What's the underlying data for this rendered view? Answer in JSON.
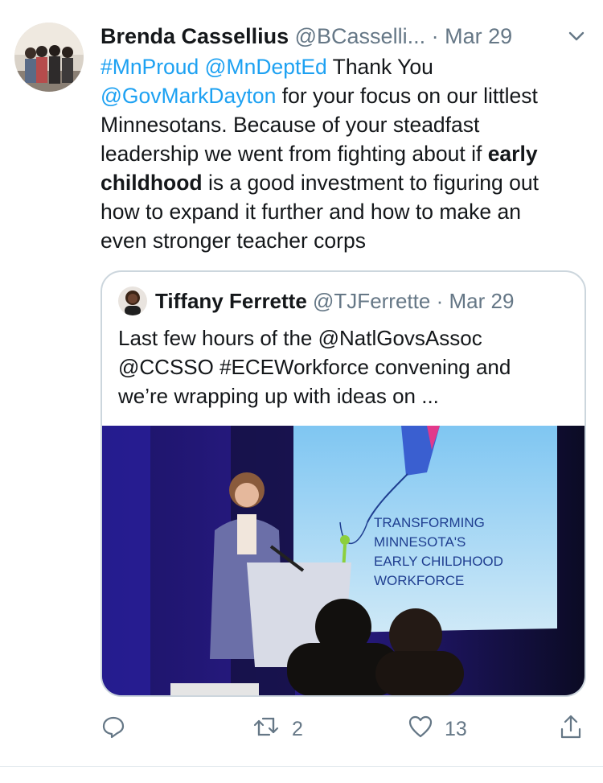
{
  "tweet": {
    "author_name": "Brenda Cassellius",
    "author_handle": "@BCasselli...",
    "separator": "·",
    "date": "Mar 29",
    "text_segments": {
      "s1": "#MnProud",
      "s2": "@MnDeptEd",
      "s3": " Thank You",
      "s4": "@GovMarkDayton",
      "s5": " for your focus on our littlest",
      "s6": "Minnesotans. Because of your steadfast",
      "s7": "leadership we went from fighting about if ",
      "s8": "early",
      "s9": "childhood",
      "s10": " is a good investment to figuring out",
      "s11": "how to expand it further and how to make an",
      "s12": "even stronger teacher corps"
    },
    "space": " "
  },
  "quoted_tweet": {
    "author_name": "Tiffany Ferrette",
    "author_handle": "@TJFerrette",
    "separator": "·",
    "date": "Mar 29",
    "lines": [
      "Last few hours of the @NatlGovsAssoc",
      "@CCSSO #ECEWorkforce convening and",
      "we’re wrapping up with ideas on ..."
    ],
    "slide_lines": [
      "TRANSFORMING",
      "MINNESOTA'S",
      "EARLY CHILDHOOD",
      "WORKFORCE"
    ]
  },
  "actions": {
    "reply_icon": "reply-icon",
    "retweet_count": "2",
    "like_count": "13",
    "share_icon": "share-icon"
  },
  "colors": {
    "link": "#1da1f2",
    "muted": "#657786",
    "text": "#14171a",
    "border": "#ccd6dd"
  }
}
